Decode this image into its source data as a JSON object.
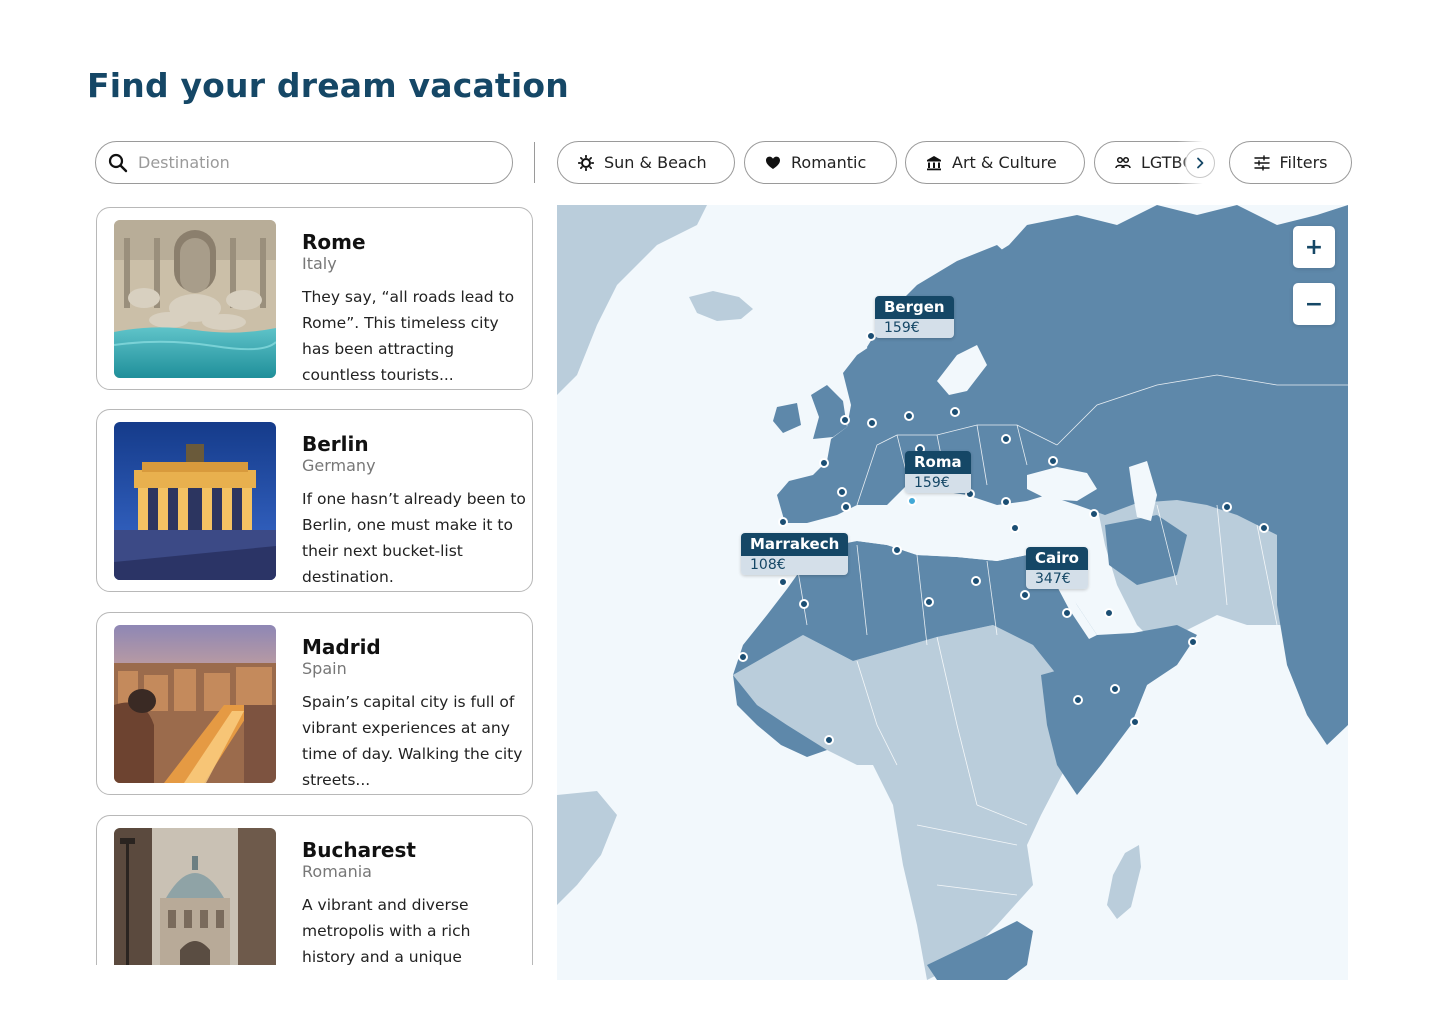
{
  "page": {
    "title": "Find your dream vacation"
  },
  "search": {
    "placeholder": "Destination"
  },
  "chips": [
    {
      "label": "Sun & Beach",
      "icon": "sun-icon"
    },
    {
      "label": "Romantic",
      "icon": "heart-icon"
    },
    {
      "label": "Art & Culture",
      "icon": "museum-icon"
    },
    {
      "label": "LGTBQ",
      "icon": "people-icon"
    }
  ],
  "filters": {
    "label": "Filters",
    "icon": "sliders-icon"
  },
  "destinations": [
    {
      "city": "Rome",
      "country": "Italy",
      "description": "They say, “all roads lead to Rome”. This timeless city has been attracting countless tourists..."
    },
    {
      "city": "Berlin",
      "country": "Germany",
      "description": "If one hasn’t already been to Berlin, one must make it to their next bucket-list destination."
    },
    {
      "city": "Madrid",
      "country": "Spain",
      "description": "Spain’s capital city is full of vibrant experiences at any time of day. Walking the city streets..."
    },
    {
      "city": "Bucharest",
      "country": "Romania",
      "description": "A vibrant and diverse metropolis with a rich history and a unique"
    }
  ],
  "map": {
    "zoom_in": "+",
    "zoom_out": "−",
    "price_labels": [
      {
        "name": "Bergen",
        "price": "159€"
      },
      {
        "name": "Roma",
        "price": "159€"
      },
      {
        "name": "Marrakech",
        "price": "108€"
      },
      {
        "name": "Cairo",
        "price": "347€"
      }
    ]
  },
  "colors": {
    "title": "#154766",
    "land_highlight": "#5e88aa",
    "land_muted": "#bacddb",
    "sea": "#f2f8fc"
  }
}
